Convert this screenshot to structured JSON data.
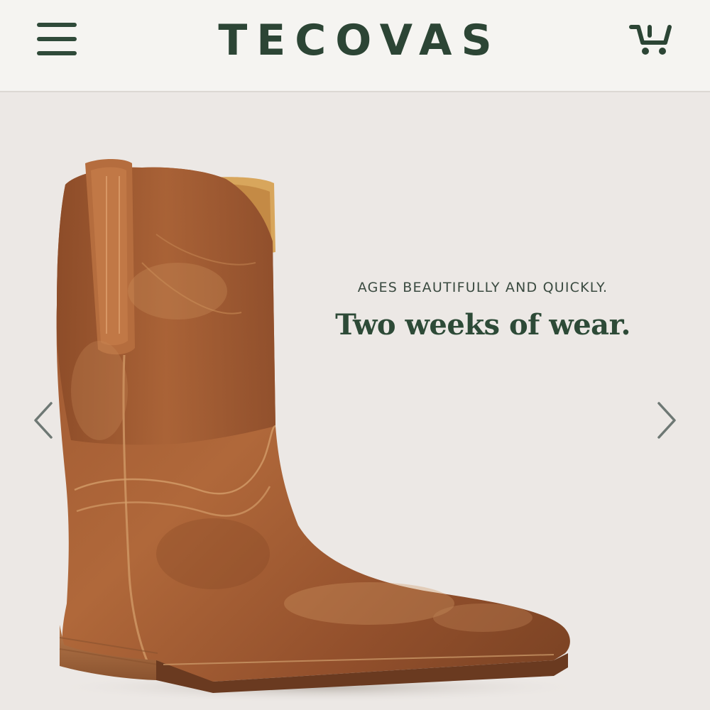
{
  "header": {
    "brand": "TECOVAS",
    "menu_icon": "hamburger-menu-icon",
    "cart_icon": "shopping-cart-icon"
  },
  "hero": {
    "eyebrow": "AGES BEAUTIFULLY AND QUICKLY.",
    "headline": "Two weeks of wear.",
    "prev_icon": "chevron-left-icon",
    "next_icon": "chevron-right-icon",
    "image": "brown-leather-cowboy-boot"
  },
  "colors": {
    "brand_green": "#2c4535",
    "header_bg": "#f5f4f1",
    "hero_bg": "#ece8e5",
    "leather": "#a05a32"
  }
}
